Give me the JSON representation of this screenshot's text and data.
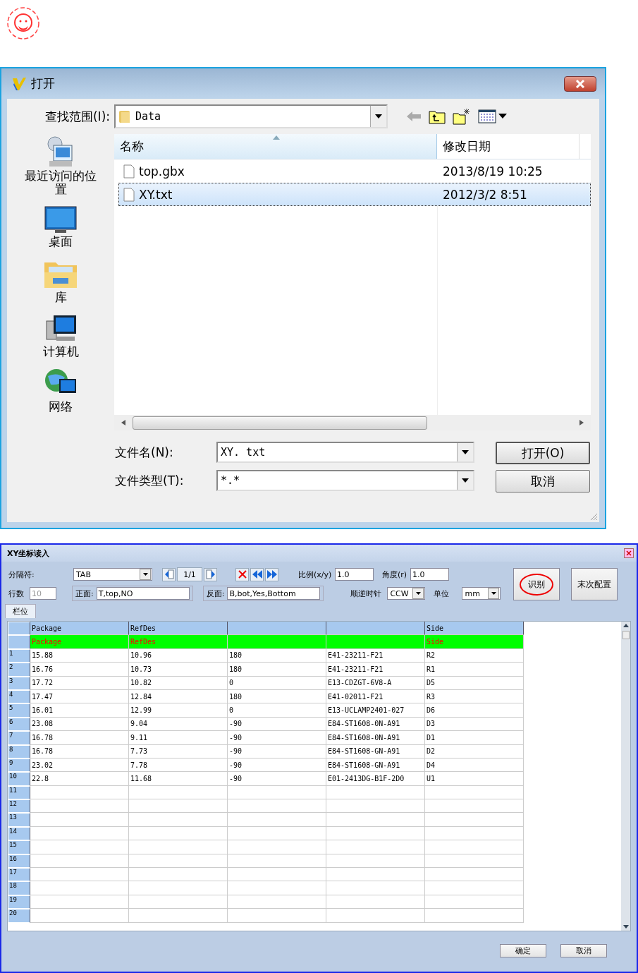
{
  "open_dialog": {
    "title": "打开",
    "look_in_label": "查找范围(I):",
    "look_in_value": "Data",
    "places": [
      {
        "kind": "recent",
        "label": "最近访问的位置"
      },
      {
        "kind": "desktop",
        "label": "桌面"
      },
      {
        "kind": "library",
        "label": "库"
      },
      {
        "kind": "computer",
        "label": "计算机"
      },
      {
        "kind": "network",
        "label": "网络"
      }
    ],
    "columns": [
      "名称",
      "修改日期"
    ],
    "files": [
      {
        "name": "top.gbx",
        "modified": "2013/8/19 10:25",
        "selected": false
      },
      {
        "name": "XY.txt",
        "modified": "2012/3/2 8:51",
        "selected": true
      }
    ],
    "file_name_label": "文件名(N):",
    "file_name": "XY. txt",
    "file_type_label": "文件类型(T):",
    "file_type": "*.*",
    "buttons": [
      "打开(O)",
      "取消"
    ]
  },
  "xy_dialog": {
    "title": "XY坐标读入",
    "separator_label": "分隔符:",
    "separator": "TAB",
    "page": "1/1",
    "row_count_label": "行数",
    "row_count": "10",
    "row_count_disabled": true,
    "front_label": "正面:",
    "front": "T,top,NO",
    "back_label": "反面:",
    "back": "B,bot,Yes,Bottom",
    "scale_label": "比例(x/y)",
    "scale": "1.0",
    "angle_label": "角度(r)",
    "angle": "1.0",
    "rotation_label": "顺逆时针",
    "rotation": "CCW",
    "unit_label": "单位",
    "unit": "mm",
    "big_buttons": [
      {
        "label": "识别",
        "highlighted": true
      },
      {
        "label": "末次配置",
        "highlighted": false
      }
    ],
    "tabs": [
      {
        "label": "栏位",
        "selected": true
      }
    ],
    "columns": [
      {
        "header": "Package",
        "mapped": "Package"
      },
      {
        "header": "RefDes",
        "mapped": "RefDes"
      },
      {},
      {},
      {
        "header": "Side",
        "mapped": "Side"
      }
    ],
    "rows": [
      {
        "number": "1",
        "cells": [
          "15.88",
          "10.96",
          "180",
          "E41-23211-F21",
          "R2"
        ]
      },
      {
        "number": "2",
        "cells": [
          "16.76",
          "10.73",
          "180",
          "E41-23211-F21",
          "R1"
        ]
      },
      {
        "number": "3",
        "cells": [
          "17.72",
          "10.82",
          "0",
          "E13-CDZGT-6V8-A",
          "D5"
        ]
      },
      {
        "number": "4",
        "cells": [
          "17.47",
          "12.84",
          "180",
          "E41-02011-F21",
          "R3"
        ]
      },
      {
        "number": "5",
        "cells": [
          "16.01",
          "12.99",
          "0",
          "E13-UCLAMP2401-027",
          "D6"
        ]
      },
      {
        "number": "6",
        "cells": [
          "23.08",
          "9.04",
          "-90",
          "E84-ST1608-0N-A91",
          "D3"
        ]
      },
      {
        "number": "7",
        "cells": [
          "16.78",
          "9.11",
          "-90",
          "E84-ST1608-0N-A91",
          "D1"
        ]
      },
      {
        "number": "8",
        "cells": [
          "16.78",
          "7.73",
          "-90",
          "E84-ST1608-GN-A91",
          "D2"
        ]
      },
      {
        "number": "9",
        "cells": [
          "23.02",
          "7.78",
          "-90",
          "E84-ST1608-GN-A91",
          "D4"
        ]
      },
      {
        "number": "10",
        "cells": [
          "22.8",
          "11.68",
          "-90",
          "E01-2413DG-B1F-2D0",
          "U1"
        ]
      },
      {
        "number": "11"
      },
      {
        "number": "12"
      },
      {
        "number": "13"
      },
      {
        "number": "14"
      },
      {
        "number": "15"
      },
      {
        "number": "16"
      },
      {
        "number": "17"
      },
      {
        "number": "18"
      },
      {
        "number": "19"
      },
      {
        "number": "20"
      }
    ],
    "buttons": [
      "确定",
      "取消"
    ]
  }
}
